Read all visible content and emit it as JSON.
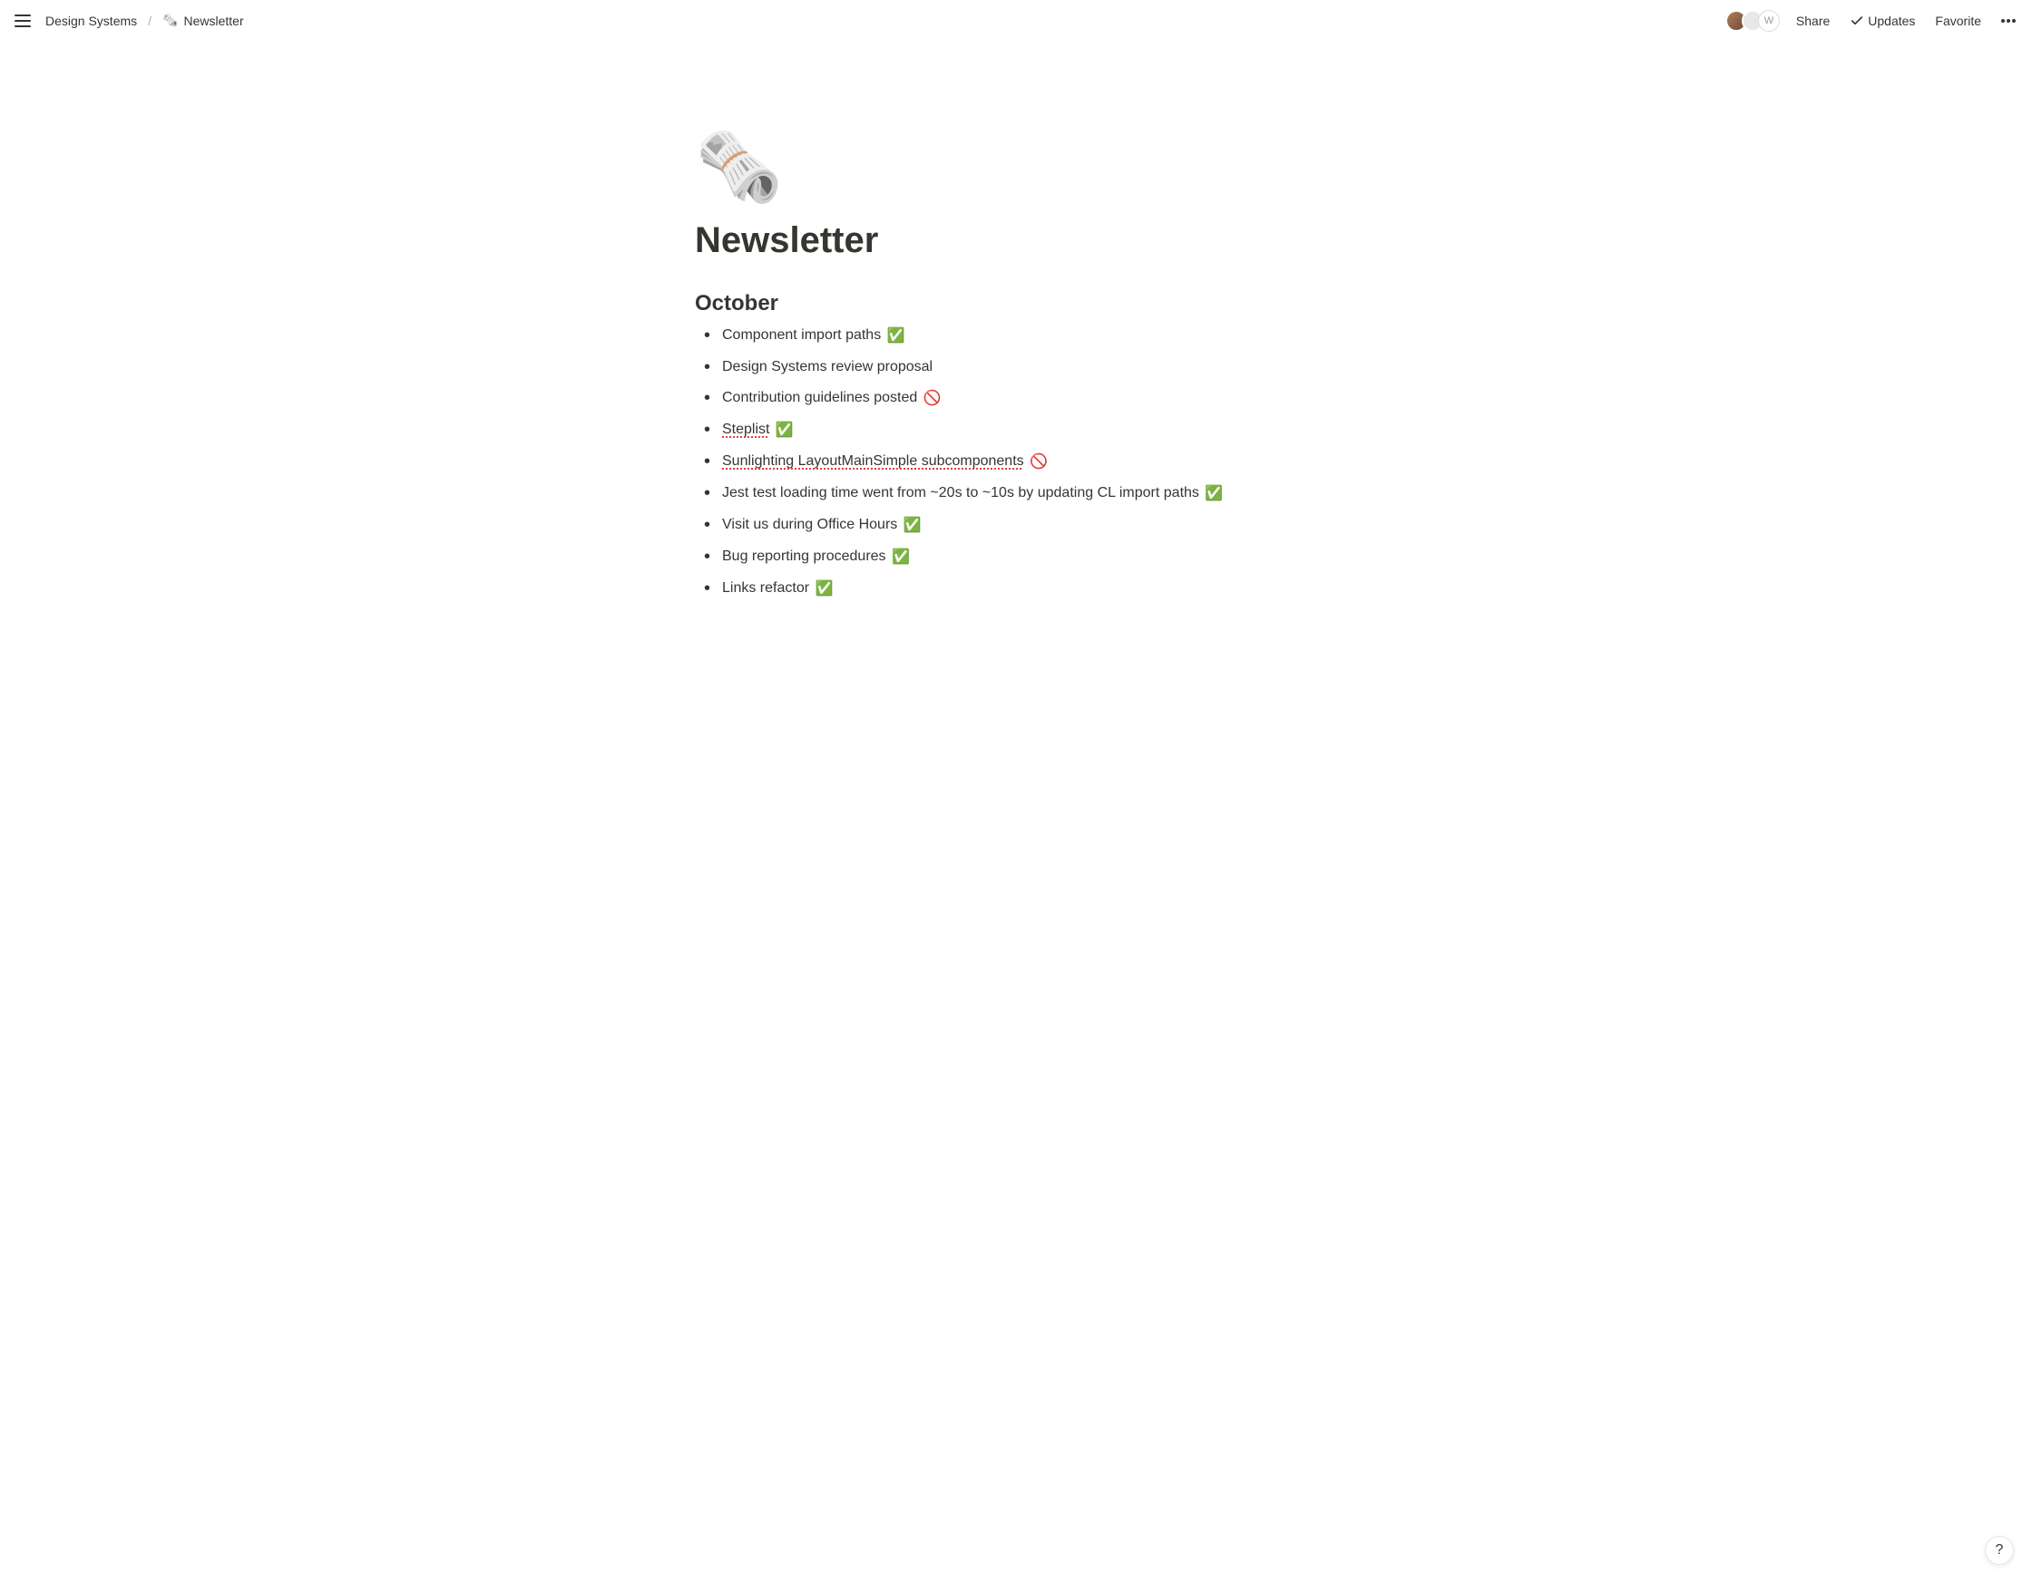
{
  "topbar": {
    "breadcrumbs": {
      "parent": "Design Systems",
      "separator": "/",
      "current_icon": "🗞️",
      "current": "Newsletter"
    },
    "actions": {
      "share": "Share",
      "updates": "Updates",
      "favorite": "Favorite"
    },
    "avatars": {
      "a3_initial": "W"
    }
  },
  "page": {
    "icon": "🗞️",
    "title": "Newsletter",
    "section_heading": "October",
    "items": [
      {
        "text": "Component import paths",
        "status": "✅",
        "spellcheck": false
      },
      {
        "text": "Design Systems review proposal",
        "status": "",
        "spellcheck": false
      },
      {
        "text": "Contribution guidelines posted",
        "status": "🚫",
        "spellcheck": false
      },
      {
        "text": "Steplist",
        "status": "✅",
        "spellcheck": true
      },
      {
        "text": "Sunlighting LayoutMainSimple subcomponents",
        "status": "🚫",
        "spellcheck": true
      },
      {
        "text": "Jest test loading time went from ~20s to ~10s by updating CL import paths",
        "status": "✅",
        "spellcheck": false
      },
      {
        "text": "Visit us during Office Hours",
        "status": "✅",
        "spellcheck": false
      },
      {
        "text": "Bug reporting procedures",
        "status": "✅",
        "spellcheck": false
      },
      {
        "text": "Links refactor",
        "status": "✅",
        "spellcheck": false
      }
    ]
  },
  "help": {
    "label": "?"
  }
}
